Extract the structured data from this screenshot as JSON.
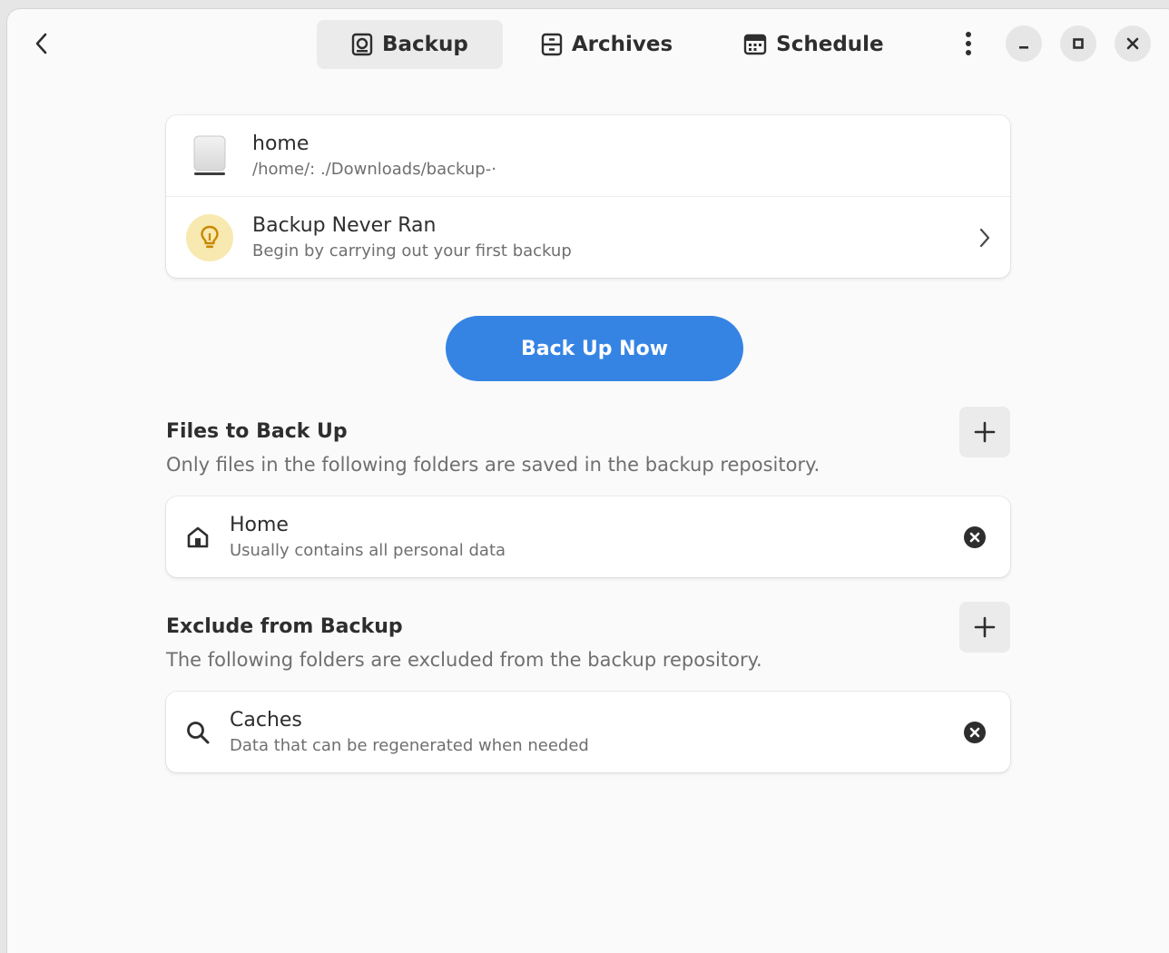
{
  "header": {
    "tabs": [
      {
        "label": "Backup",
        "icon": "backup-icon",
        "active": true
      },
      {
        "label": "Archives",
        "icon": "archive-icon",
        "active": false
      },
      {
        "label": "Schedule",
        "icon": "calendar-icon",
        "active": false
      }
    ]
  },
  "repository": {
    "name": "home",
    "path": "/home/:    ./Downloads/backup-·"
  },
  "status": {
    "title": "Backup Never Ran",
    "subtitle": "Begin by carrying out your first backup"
  },
  "primary_action": "Back Up Now",
  "include": {
    "title": "Files to Back Up",
    "description": "Only files in the following folders are saved in the backup repository.",
    "items": [
      {
        "title": "Home",
        "subtitle": "Usually contains all personal data",
        "icon": "home-icon"
      }
    ]
  },
  "exclude": {
    "title": "Exclude from Backup",
    "description": "The following folders are excluded from the backup repository.",
    "items": [
      {
        "title": "Caches",
        "subtitle": "Data that can be regenerated when needed",
        "icon": "search-icon"
      }
    ]
  },
  "colors": {
    "accent": "#3584e4",
    "window_bg": "#fafafa",
    "card_bg": "#ffffff",
    "warning_bg": "#f7e9b0",
    "warning_fg": "#c88800"
  }
}
